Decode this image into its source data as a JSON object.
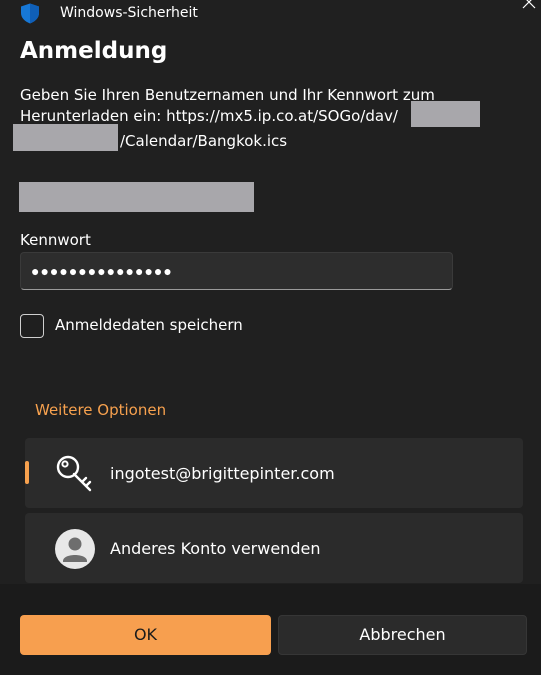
{
  "window": {
    "title": "Windows-Sicherheit",
    "icon": "shield-icon",
    "close_icon": "close-icon"
  },
  "heading": "Anmeldung",
  "message": {
    "line1": "Geben Sie Ihren Benutzernamen und Ihr Kennwort zum",
    "line2": "Herunterladen ein: https://mx5.ip.co.at/SOGo/dav/",
    "line3": "/Calendar/Bangkok.ics"
  },
  "password": {
    "label": "Kennwort",
    "value": "●●●●●●●●●●●●●●●"
  },
  "remember": {
    "label": "Anmeldedaten speichern",
    "checked": false
  },
  "more_options": {
    "label": "Weitere Optionen",
    "accounts": [
      {
        "label": "ingotest@brigittepinter.com",
        "icon": "key-icon",
        "selected": true
      },
      {
        "label": "Anderes Konto verwenden",
        "icon": "user-avatar-icon",
        "selected": false
      }
    ]
  },
  "buttons": {
    "ok": "OK",
    "cancel": "Abbrechen"
  },
  "colors": {
    "accent": "#f7a14e",
    "background": "#202020",
    "redaction": "#a8a7ab"
  }
}
